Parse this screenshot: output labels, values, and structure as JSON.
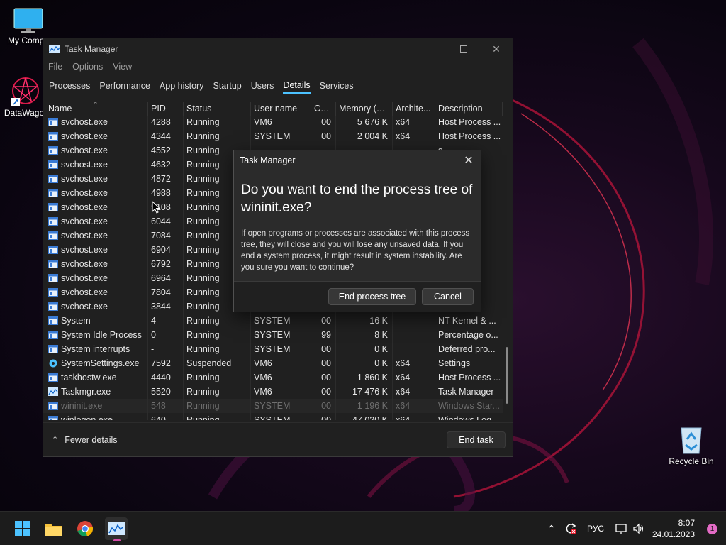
{
  "desktop": {
    "icons": [
      {
        "label": "My Compu",
        "icon": "monitor-icon"
      },
      {
        "label": "DataWagor",
        "icon": "datawagon-icon"
      },
      {
        "label": "Recycle Bin",
        "icon": "recycle-bin-icon"
      }
    ]
  },
  "window": {
    "title": "Task Manager",
    "menu": [
      "File",
      "Options",
      "View"
    ],
    "tabs": [
      "Processes",
      "Performance",
      "App history",
      "Startup",
      "Users",
      "Details",
      "Services"
    ],
    "active_tab": "Details",
    "columns": [
      "Name",
      "PID",
      "Status",
      "User name",
      "CPU",
      "Memory (a...",
      "Archite...",
      "Description"
    ],
    "rows": [
      {
        "name": "svchost.exe",
        "pid": "4288",
        "status": "Running",
        "user": "VM6",
        "cpu": "00",
        "mem": "5 676 K",
        "arch": "x64",
        "desc": "Host Process ..."
      },
      {
        "name": "svchost.exe",
        "pid": "4344",
        "status": "Running",
        "user": "SYSTEM",
        "cpu": "00",
        "mem": "2 004 K",
        "arch": "x64",
        "desc": "Host Process ..."
      },
      {
        "name": "svchost.exe",
        "pid": "4552",
        "status": "Running",
        "user": "",
        "cpu": "",
        "mem": "",
        "arch": "",
        "desc": "s ..."
      },
      {
        "name": "svchost.exe",
        "pid": "4632",
        "status": "Running",
        "user": "",
        "cpu": "",
        "mem": "",
        "arch": "",
        "desc": "s ..."
      },
      {
        "name": "svchost.exe",
        "pid": "4872",
        "status": "Running",
        "user": "",
        "cpu": "",
        "mem": "",
        "arch": "",
        "desc": "s ..."
      },
      {
        "name": "svchost.exe",
        "pid": "4988",
        "status": "Running",
        "user": "",
        "cpu": "",
        "mem": "",
        "arch": "",
        "desc": "s ..."
      },
      {
        "name": "svchost.exe",
        "pid": "5108",
        "status": "Running",
        "user": "",
        "cpu": "",
        "mem": "",
        "arch": "",
        "desc": "s ..."
      },
      {
        "name": "svchost.exe",
        "pid": "6044",
        "status": "Running",
        "user": "",
        "cpu": "",
        "mem": "",
        "arch": "",
        "desc": "s ..."
      },
      {
        "name": "svchost.exe",
        "pid": "7084",
        "status": "Running",
        "user": "",
        "cpu": "",
        "mem": "",
        "arch": "",
        "desc": "s ..."
      },
      {
        "name": "svchost.exe",
        "pid": "6904",
        "status": "Running",
        "user": "",
        "cpu": "",
        "mem": "",
        "arch": "",
        "desc": "s ..."
      },
      {
        "name": "svchost.exe",
        "pid": "6792",
        "status": "Running",
        "user": "",
        "cpu": "",
        "mem": "",
        "arch": "",
        "desc": "s ..."
      },
      {
        "name": "svchost.exe",
        "pid": "6964",
        "status": "Running",
        "user": "",
        "cpu": "",
        "mem": "",
        "arch": "",
        "desc": "s ..."
      },
      {
        "name": "svchost.exe",
        "pid": "7804",
        "status": "Running",
        "user": "",
        "cpu": "",
        "mem": "",
        "arch": "",
        "desc": "s ..."
      },
      {
        "name": "svchost.exe",
        "pid": "3844",
        "status": "Running",
        "user": "",
        "cpu": "",
        "mem": "",
        "arch": "",
        "desc": "s ..."
      },
      {
        "name": "System",
        "pid": "4",
        "status": "Running",
        "user": "SYSTEM",
        "cpu": "00",
        "mem": "16 K",
        "arch": "",
        "desc": "NT Kernel & ..."
      },
      {
        "name": "System Idle Process",
        "pid": "0",
        "status": "Running",
        "user": "SYSTEM",
        "cpu": "99",
        "mem": "8 K",
        "arch": "",
        "desc": "Percentage o..."
      },
      {
        "name": "System interrupts",
        "pid": "-",
        "status": "Running",
        "user": "SYSTEM",
        "cpu": "00",
        "mem": "0 K",
        "arch": "",
        "desc": "Deferred pro..."
      },
      {
        "name": "SystemSettings.exe",
        "pid": "7592",
        "status": "Suspended",
        "user": "VM6",
        "cpu": "00",
        "mem": "0 K",
        "arch": "x64",
        "desc": "Settings"
      },
      {
        "name": "taskhostw.exe",
        "pid": "4440",
        "status": "Running",
        "user": "VM6",
        "cpu": "00",
        "mem": "1 860 K",
        "arch": "x64",
        "desc": "Host Process ..."
      },
      {
        "name": "Taskmgr.exe",
        "pid": "5520",
        "status": "Running",
        "user": "VM6",
        "cpu": "00",
        "mem": "17 476 K",
        "arch": "x64",
        "desc": "Task Manager"
      },
      {
        "name": "wininit.exe",
        "pid": "548",
        "status": "Running",
        "user": "SYSTEM",
        "cpu": "00",
        "mem": "1 196 K",
        "arch": "x64",
        "desc": "Windows Star..."
      },
      {
        "name": "winlogon.exe",
        "pid": "640",
        "status": "Running",
        "user": "SYSTEM",
        "cpu": "00",
        "mem": "47 020 K",
        "arch": "x64",
        "desc": "Windows Log..."
      }
    ],
    "fewer_details": "Fewer details",
    "end_task": "End task"
  },
  "dialog": {
    "title": "Task Manager",
    "heading": "Do you want to end the process tree of wininit.exe?",
    "body": "If open programs or processes are associated with this process tree, they will close and you will lose any unsaved data. If you end a system process, it might result in system instability. Are you sure you want to continue?",
    "confirm": "End process tree",
    "cancel": "Cancel"
  },
  "taskbar": {
    "apps": [
      "windows-start-icon",
      "file-explorer-icon",
      "chrome-icon",
      "task-manager-icon"
    ],
    "language": "РУС",
    "time": "8:07",
    "date": "24.01.2023",
    "notifications": "1"
  }
}
